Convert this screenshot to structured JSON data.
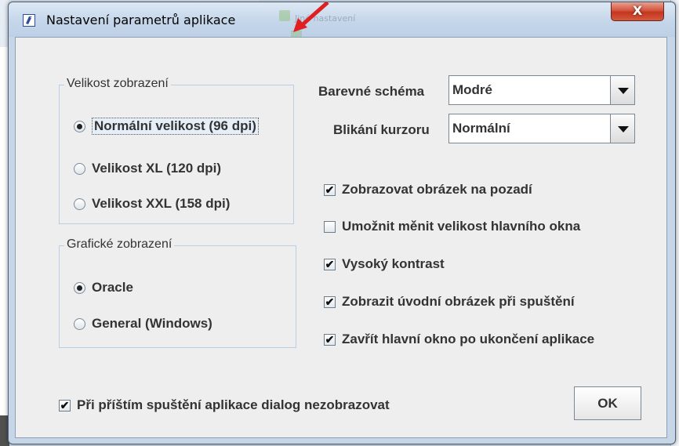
{
  "window": {
    "title": "Nastavení parametrů aplikace",
    "close_label": "X",
    "background_faded_text": "Jiné nastavení"
  },
  "display_size": {
    "title": "Velikost zobrazení",
    "options": [
      {
        "label": "Normální velikost (96 dpi)",
        "selected": true
      },
      {
        "label": "Velikost XL (120 dpi)",
        "selected": false
      },
      {
        "label": "Velikost XXL (158 dpi)",
        "selected": false
      }
    ]
  },
  "graphics": {
    "title": "Grafické zobrazení",
    "options": [
      {
        "label": "Oracle",
        "selected": true
      },
      {
        "label": "General (Windows)",
        "selected": false
      }
    ]
  },
  "color_scheme": {
    "label": "Barevné schéma",
    "value": "Modré"
  },
  "cursor_blink": {
    "label": "Blikání kurzoru",
    "value": "Normální"
  },
  "checkboxes": [
    {
      "label": "Zobrazovat obrázek na pozadí",
      "checked": true
    },
    {
      "label": "Umožnit měnit velikost hlavního okna",
      "checked": false
    },
    {
      "label": "Vysoký kontrast",
      "checked": true
    },
    {
      "label": "Zobrazit úvodní obrázek při spuštění",
      "checked": true
    },
    {
      "label": "Zavřít hlavní okno po ukončení aplikace",
      "checked": true
    }
  ],
  "dont_show_again": {
    "label": "Při příštím spuštění aplikace dialog nezobrazovat",
    "checked": true
  },
  "ok_label": "OK",
  "colors": {
    "titlebar": "#c5d6ea",
    "content_bg": "#eeeeee",
    "close_red": "#c3361f",
    "annotation_arrow": "#e02020"
  }
}
